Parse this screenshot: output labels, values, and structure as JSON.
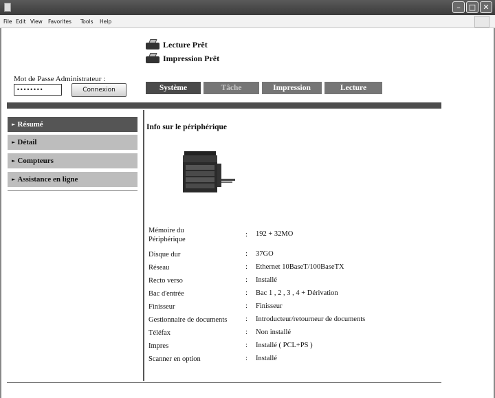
{
  "menubar": {
    "items": [
      "File",
      "Edit",
      "View",
      "Favorites",
      "Tools",
      "Help"
    ]
  },
  "status": {
    "lecture": "Lecture Prêt",
    "impression": "Impression Prêt"
  },
  "login": {
    "label": "Mot de Passe Administrateur :",
    "password_value": "••••••••",
    "button_label": "Connexion"
  },
  "tabs": [
    "Système",
    "Tâche",
    "Impression",
    "Lecture"
  ],
  "sidebar": {
    "items": [
      {
        "label": "Résumé"
      },
      {
        "label": "Détail"
      },
      {
        "label": "Compteurs"
      },
      {
        "label": "Assistance en ligne"
      }
    ]
  },
  "main": {
    "title": "Info sur le périphérique",
    "rows": [
      {
        "label": "Mémoire du Périphérique",
        "value": "192 + 32MO"
      },
      {
        "label": "Disque dur",
        "value": "37GO"
      },
      {
        "label": "Réseau",
        "value": "Ethernet 10BaseT/100BaseTX"
      },
      {
        "label": "Recto verso",
        "value": "Installé"
      },
      {
        "label": "Bac d'entrée",
        "value": "Bac 1 , 2 , 3 , 4 + Dérivation"
      },
      {
        "label": "Finisseur",
        "value": "Finisseur"
      },
      {
        "label": "Gestionnaire de documents",
        "value": "Introducteur/retourneur de documents"
      },
      {
        "label": "Téléfax",
        "value": "Non installé"
      },
      {
        "label": "Impres",
        "value": "Installé ( PCL+PS )"
      },
      {
        "label": "Scanner en option",
        "value": "Installé"
      }
    ],
    "colon": ":"
  }
}
